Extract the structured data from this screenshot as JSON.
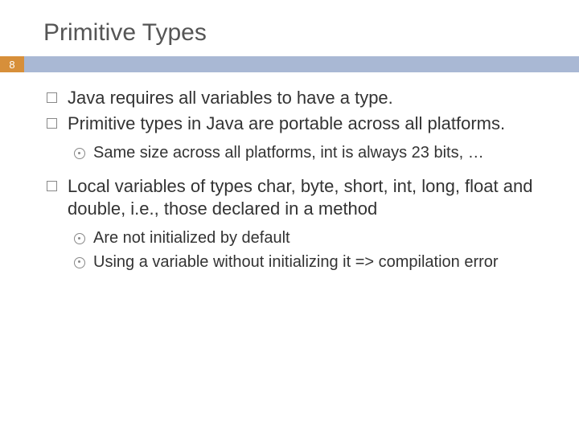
{
  "title": "Primitive Types",
  "page_number": "8",
  "bullets": {
    "b1": "Java requires all variables to have a type.",
    "b2": "Primitive types in Java are portable across all platforms.",
    "b2_1": "Same size across all platforms, int is always 23 bits, …",
    "b3": "Local variables of types char, byte, short, int, long, float and double, i.e., those declared in a method",
    "b3_1": "Are not initialized by default",
    "b3_2": "Using a variable without initializing it => compilation error"
  }
}
